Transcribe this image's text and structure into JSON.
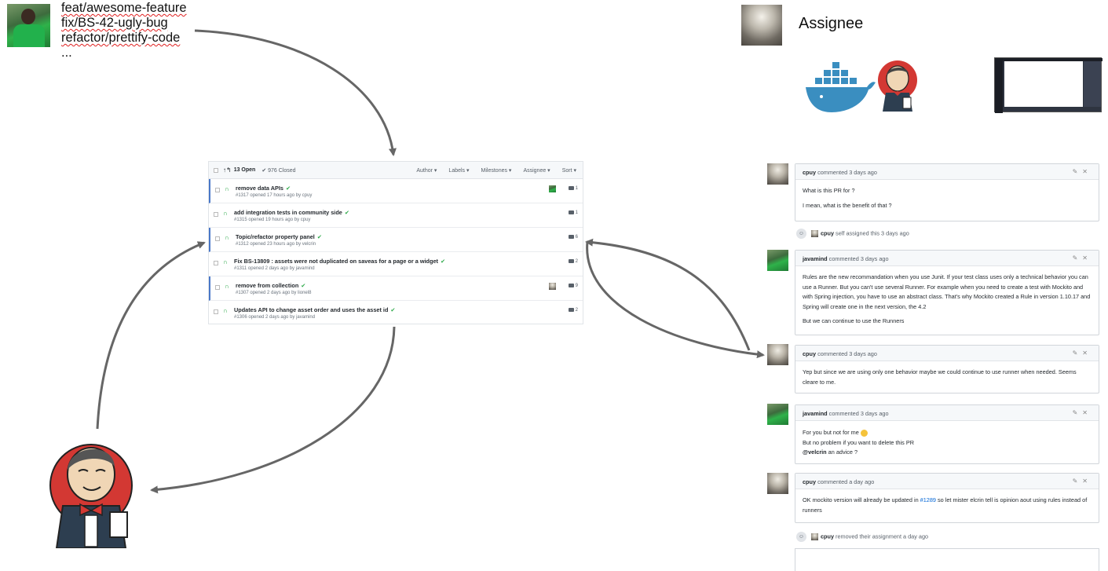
{
  "branches": [
    "feat/awesome-feature",
    "fix/BS-42-ugly-bug",
    "refactor/prettify-code",
    "..."
  ],
  "assignee_label": "Assignee",
  "pr_list": {
    "open_count": "13 Open",
    "closed_count": "976 Closed",
    "filters": [
      "Author ▾",
      "Labels ▾",
      "Milestones ▾",
      "Assignee ▾",
      "Sort ▾"
    ],
    "rows": [
      {
        "title": "remove data APIs",
        "meta": "#1317 opened 17 hours ago by cpuy",
        "comments": "1"
      },
      {
        "title": "add integration tests in community side",
        "meta": "#1315 opened 19 hours ago by cpuy",
        "comments": "1"
      },
      {
        "title": "Topic/refactor property panel",
        "meta": "#1312 opened 23 hours ago by velcrin",
        "comments": "6"
      },
      {
        "title": "Fix BS-13809 : assets were not duplicated on saveas for a page or a widget",
        "meta": "#1311 opened 2 days ago by javamind",
        "comments": "2"
      },
      {
        "title": "remove from collection",
        "meta": "#1307 opened 2 days ago by lionel8",
        "comments": "9"
      },
      {
        "title": "Updates API to change asset order and uses the asset id",
        "meta": "#1306 opened 2 days ago by javamind",
        "comments": "2"
      }
    ]
  },
  "comments": [
    {
      "author": "cpuy",
      "action": "commented 3 days ago",
      "lines": [
        "What is this PR for ?",
        "I mean, what is the benefit of that ?"
      ]
    },
    {
      "author": "javamind",
      "action": "commented 3 days ago",
      "lines": [
        "Rules are the new recommandation when you use Junit. If your test class uses only a technical behavior you can use a Runner. But you can't use several Runner. For example when you need to create a test with Mockito and with Spring injection, you have to use an abstract class. That's why Mockito created a Rule in version 1.10.17 and Spring will create one in the next version, the 4.2",
        "But we can continue to use the Runners"
      ]
    },
    {
      "author": "cpuy",
      "action": "commented 3 days ago",
      "lines": [
        "Yep but since we are using only one behavior maybe we could continue to use runner when needed. Seems cleare to me."
      ]
    },
    {
      "author": "javamind",
      "action": "commented 3 days ago",
      "line1": "For you but not for me",
      "line2": "But no problem if you want to delete this PR",
      "mention": "@velcrin",
      "mention_rest": " an advice ?"
    },
    {
      "author": "cpuy",
      "action": "commented a day ago",
      "pre": "OK mockito version will already be updated in ",
      "link": "#1289",
      "post": " so let mister elcrin tell is opinion aout using rules instead of runners"
    }
  ],
  "events": [
    {
      "who": "cpuy",
      "text": " self assigned this 3 days ago"
    },
    {
      "who": "cpuy",
      "text": " removed their assignment a day ago"
    }
  ],
  "icons": [
    "developer-avatar",
    "assignee-avatar",
    "docker-whale-icon",
    "jenkins-butler-icon",
    "ci-screenshot-thumbnail"
  ],
  "colors": {
    "docker_blue": "#3a8ec0",
    "jenkins_red": "#d33833",
    "arrow_gray": "#666666",
    "check_green": "#28a745"
  }
}
